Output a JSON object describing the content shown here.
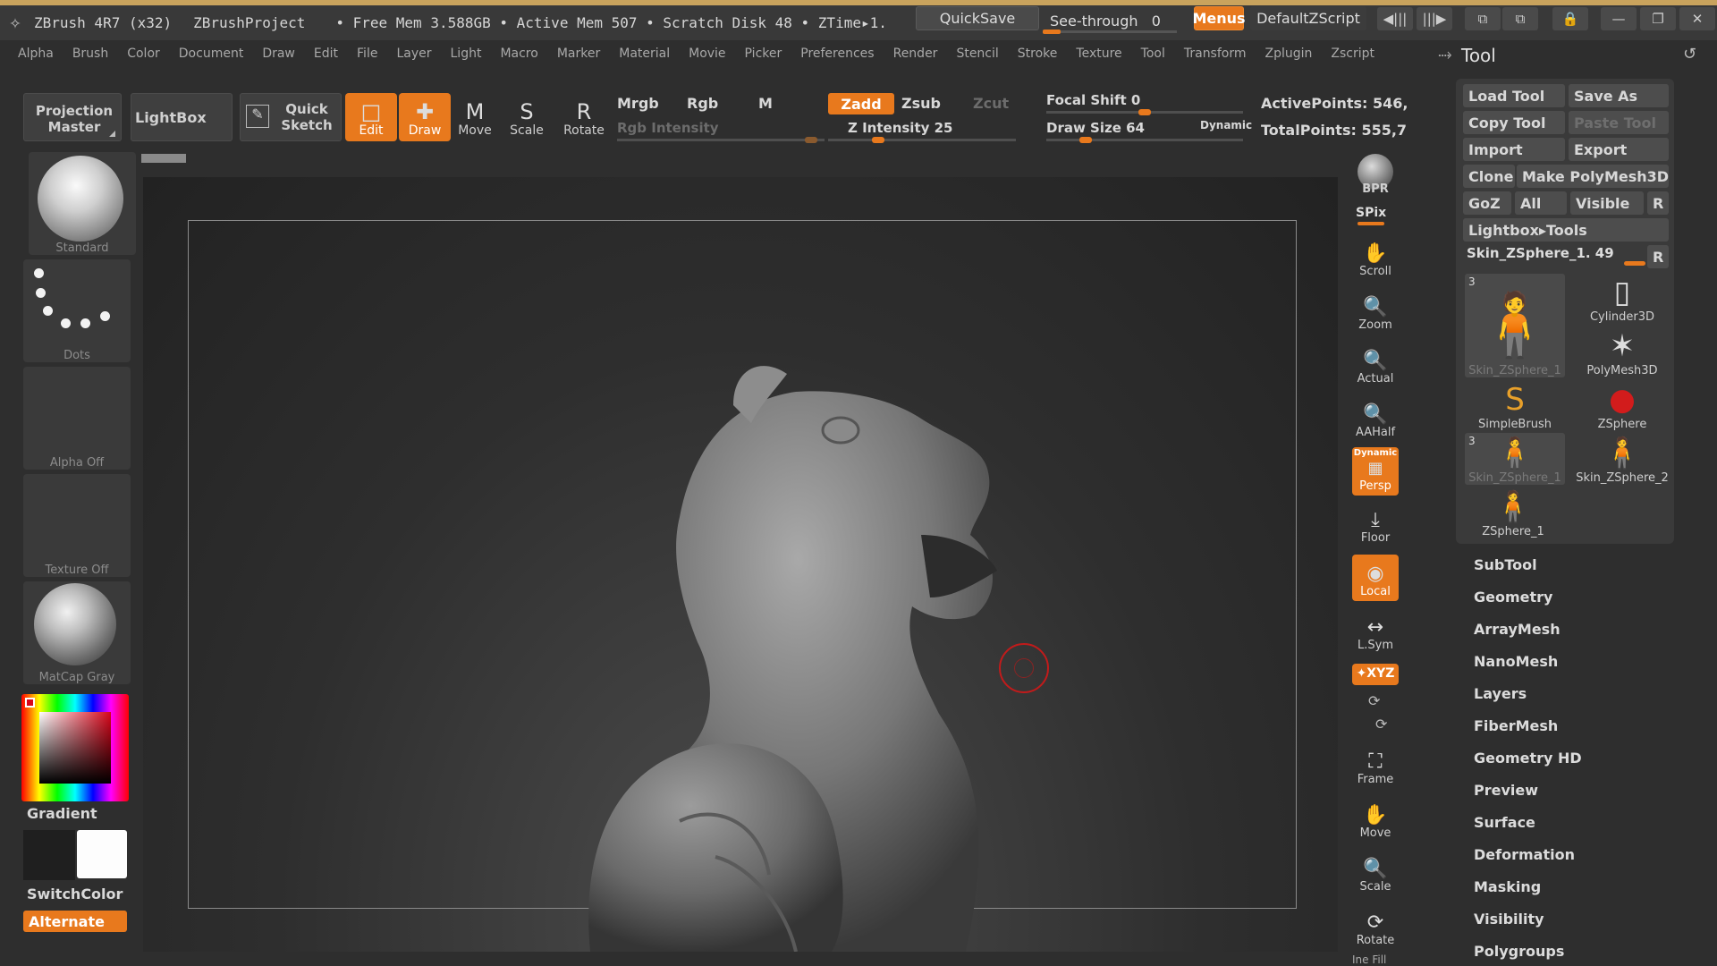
{
  "colors": {
    "accent": "#e8791d",
    "panel": "#3a3a3a",
    "background": "#2e2e2e",
    "cursor": "#c11b1b"
  },
  "titlebar": {
    "app": "ZBrush 4R7 (x32)",
    "project": "ZBrushProject",
    "status": "• Free Mem 3.588GB • Active Mem 507 • Scratch Disk 48 •  ZTime▸1.",
    "quicksave": "QuickSave",
    "see_through": "See-through",
    "see_through_value": "0",
    "see_through_level": 0,
    "menus": "Menus",
    "script": "DefaultZScript"
  },
  "menubar": [
    "Alpha",
    "Brush",
    "Color",
    "Document",
    "Draw",
    "Edit",
    "File",
    "Layer",
    "Light",
    "Macro",
    "Marker",
    "Material",
    "Movie",
    "Picker",
    "Preferences",
    "Render",
    "Stencil",
    "Stroke",
    "Texture",
    "Tool",
    "Transform",
    "Zplugin",
    "Zscript"
  ],
  "toolbar": {
    "projection_master": "Projection Master",
    "lightbox": "LightBox",
    "quick_sketch": "Quick Sketch",
    "edit": "Edit",
    "draw": "Draw",
    "move": "Move",
    "scale": "Scale",
    "rotate": "Rotate",
    "mrgb": "Mrgb",
    "rgb": "Rgb",
    "m": "M",
    "rgb_intensity": "Rgb Intensity",
    "zadd": "Zadd",
    "zsub": "Zsub",
    "zcut": "Zcut",
    "z_intensity": "Z Intensity 25",
    "z_intensity_value": 25,
    "focal_shift": "Focal Shift 0",
    "focal_shift_value": 0,
    "draw_size": "Draw Size 64",
    "draw_size_value": 64,
    "dynamic": "Dynamic",
    "active_points": "ActivePoints: 546,",
    "total_points": "TotalPoints: 555,7"
  },
  "left_panel": {
    "standard": "Standard",
    "dots": "Dots",
    "alpha": "Alpha  Off",
    "texture": "Texture  Off",
    "matcap": "MatCap  Gray",
    "gradient": "Gradient",
    "switchcolor": "SwitchColor",
    "alternate": "Alternate"
  },
  "right_toolbar": {
    "bpr": "BPR",
    "spix": "SPix",
    "scroll": "Scroll",
    "zoom": "Zoom",
    "actual": "Actual",
    "aahalf": "AAHalf",
    "dynamic": "Dynamic",
    "persp": "Persp",
    "floor": "Floor",
    "local": "Local",
    "lsym": "L.Sym",
    "xyz": "✦XYZ",
    "frame": "Frame",
    "move": "Move",
    "scale": "Scale",
    "rotate": "Rotate",
    "line_fill": "Ine Fill"
  },
  "tool_panel": {
    "title": "Tool",
    "load_tool": "Load Tool",
    "save_as": "Save As",
    "copy_tool": "Copy Tool",
    "paste_tool": "Paste Tool",
    "import": "Import",
    "export": "Export",
    "clone": "Clone",
    "make_polymesh": "Make PolyMesh3D",
    "goz": "GoZ",
    "all": "All",
    "visible": "Visible",
    "r": "R",
    "lightbox_tools": "Lightbox▸Tools",
    "current_tool": "Skin_ZSphere_1. 49",
    "thumbs": [
      {
        "label": "Skin_ZSphere_1",
        "num": "3"
      },
      {
        "label": "Cylinder3D",
        "num": ""
      },
      {
        "label": "PolyMesh3D",
        "num": ""
      },
      {
        "label": "SimpleBrush",
        "num": ""
      },
      {
        "label": "ZSphere",
        "num": ""
      },
      {
        "label": "Skin_ZSphere_1",
        "num": "3"
      },
      {
        "label": "Skin_ZSphere_2",
        "num": ""
      },
      {
        "label": "ZSphere_1",
        "num": ""
      }
    ],
    "sections": [
      "SubTool",
      "Geometry",
      "ArrayMesh",
      "NanoMesh",
      "Layers",
      "FiberMesh",
      "Geometry HD",
      "Preview",
      "Surface",
      "Deformation",
      "Masking",
      "Visibility",
      "Polygroups"
    ]
  }
}
